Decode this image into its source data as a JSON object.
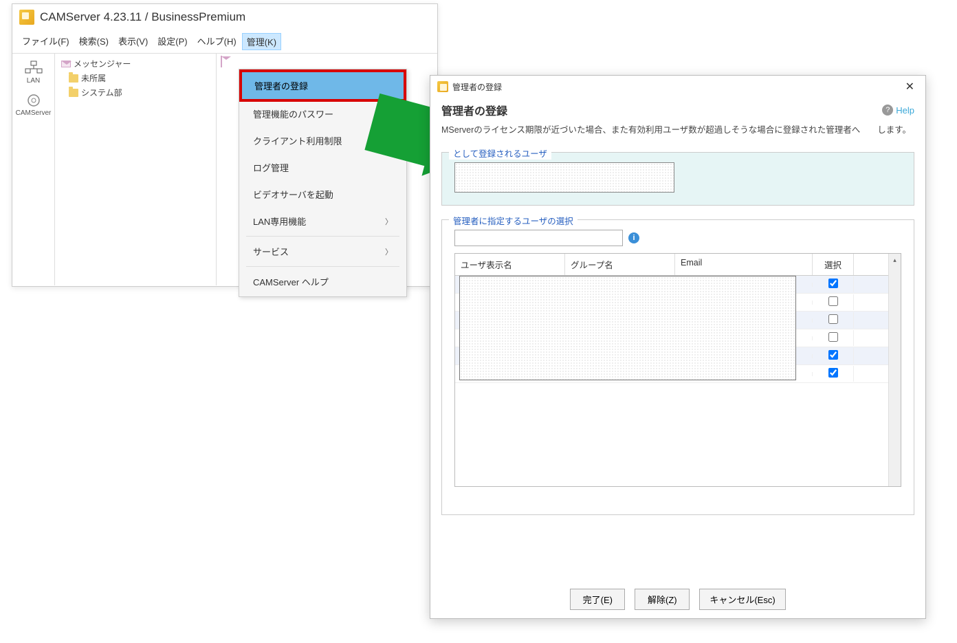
{
  "main_window": {
    "title": "CAMServer 4.23.11 / BusinessPremium",
    "menus": {
      "file": "ファイル(F)",
      "search": "検索(S)",
      "view": "表示(V)",
      "settings": "設定(P)",
      "help": "ヘルプ(H)",
      "manage": "管理(K)"
    },
    "rail": {
      "lan": "LAN",
      "camserver": "CAMServer"
    },
    "tree": {
      "messenger": "メッセンジャー",
      "unassigned": "未所属",
      "system_dept": "システム部"
    }
  },
  "manage_menu": {
    "register_admin": "管理者の登録",
    "admin_password": "管理機能のパスワー",
    "client_limit": "クライアント利用制限",
    "log": "ログ管理",
    "video_server": "ビデオサーバを起動",
    "lan_only": "LAN専用機能",
    "service": "サービス",
    "camserver_help": "CAMServer ヘルプ"
  },
  "dialog": {
    "titlebar": "管理者の登録",
    "heading": "管理者の登録",
    "help_label": "Help",
    "description": "MServerのライセンス期限が近づいた場合、また有効利用ユーザ数が超過しそうな場合に登録された管理者へ　　します。",
    "fieldset1_legend": "として登録されるユーザ",
    "fieldset2_legend": "管理者に指定するユーザの選択",
    "table": {
      "col_name": "ユーザ表示名",
      "col_group": "グループ名",
      "col_email": "Email",
      "col_select": "選択",
      "rows": [
        {
          "checked": true
        },
        {
          "checked": false
        },
        {
          "checked": false
        },
        {
          "checked": false
        },
        {
          "checked": true
        },
        {
          "checked": true
        }
      ]
    },
    "buttons": {
      "done": "完了(E)",
      "release": "解除(Z)",
      "cancel": "キャンセル(Esc)"
    }
  }
}
